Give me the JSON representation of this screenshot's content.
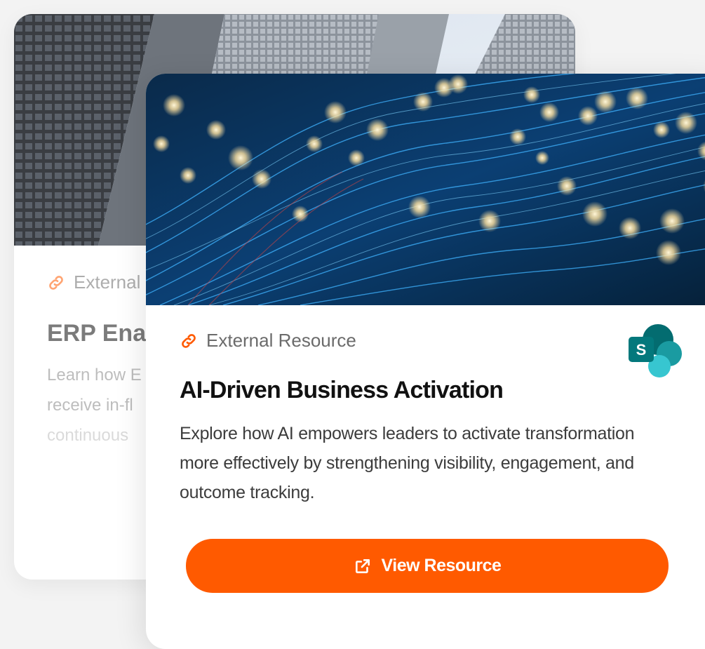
{
  "back_card": {
    "tag_label": "External",
    "title": "ERP Ena",
    "description_lines": [
      "Learn how E",
      "receive in-fl",
      "continuous"
    ]
  },
  "front_card": {
    "tag_label": "External Resource",
    "title": "AI-Driven Business Activation",
    "description": "Explore how AI empowers leaders to activate transformation more effectively by strengthening visibility, engagement, and outcome tracking.",
    "cta_label": "View Resource",
    "logo_letter": "S"
  },
  "colors": {
    "accent": "#ff5a00",
    "link_icon": "#ff5a00",
    "sharepoint_dark": "#036c70",
    "sharepoint_mid": "#1a9ba1",
    "sharepoint_light": "#37c6d0"
  },
  "icons": {
    "tag": "link-icon",
    "cta": "external-link-icon",
    "logo": "sharepoint-logo-icon"
  }
}
